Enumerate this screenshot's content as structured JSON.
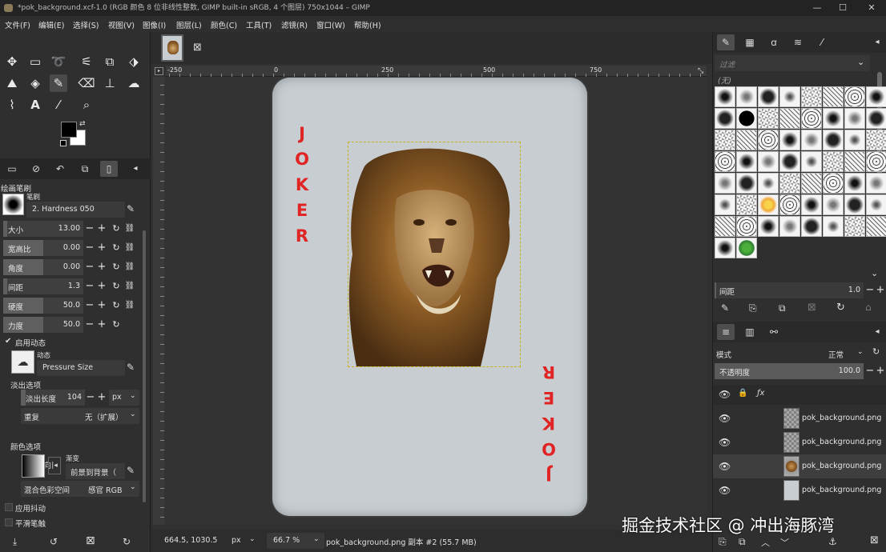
{
  "window": {
    "title": "*pok_background.xcf-1.0 (RGB 颜色 8 位非线性整数, GIMP built-in sRGB, 4 个图层) 750x1044 – GIMP",
    "minimize": "—",
    "maximize": "☐",
    "close": "✕"
  },
  "menu": [
    "文件(F)",
    "编辑(E)",
    "选择(S)",
    "视图(V)",
    "图像(I)",
    "图层(L)",
    "颜色(C)",
    "工具(T)",
    "滤镜(R)",
    "窗口(W)",
    "帮助(H)"
  ],
  "tool_options": {
    "section_title": "绘画笔刷",
    "brush_label": "笔刷",
    "brush_name": "2. Hardness 050",
    "sliders": [
      {
        "name": "大小",
        "value": "13.00",
        "fill": 0.05
      },
      {
        "name": "宽高比",
        "value": "0.00",
        "fill": 0.5
      },
      {
        "name": "角度",
        "value": "0.00",
        "fill": 0.5
      },
      {
        "name": "间距",
        "value": "1.3",
        "fill": 0.05
      },
      {
        "name": "硬度",
        "value": "50.0",
        "fill": 0.5
      },
      {
        "name": "力度",
        "value": "50.0",
        "fill": 0.5
      }
    ],
    "dynamics_enabled_label": "启用动态",
    "dynamics_label": "动态",
    "dynamics_value": "Pressure Size",
    "fade_section": "淡出选项",
    "fade_length_label": "淡出长度",
    "fade_length_value": "104",
    "fade_unit": "px",
    "repeat_label": "重复",
    "repeat_value": "无（扩展）",
    "reverse_label": "反向",
    "color_section": "颜色选项",
    "gradient_label": "渐变",
    "gradient_value": "前景到背景（",
    "blend_space_label": "混合色彩空间",
    "blend_space_value": "感官 RGB",
    "jitter_label": "应用抖动",
    "smooth_label": "平滑笔触"
  },
  "canvas": {
    "ruler_marks": [
      "-250",
      "0",
      "250",
      "500",
      "750"
    ],
    "card_text_top": [
      "J",
      "O",
      "K",
      "E",
      "R"
    ],
    "card_text_bottom": [
      "R",
      "E",
      "K",
      "O",
      "J"
    ]
  },
  "status": {
    "coords": "664.5, 1030.5",
    "unit": "px",
    "zoom": "66.7 %",
    "info": "pok_background.png 副本 #2 (55.7 MB)"
  },
  "brushes_panel": {
    "filter_placeholder": "过滤",
    "tag": "(无)",
    "spacing_label": "间距",
    "spacing_value": "1.0"
  },
  "layers_panel": {
    "mode_label": "模式",
    "mode_value": "正常",
    "opacity_label": "不透明度",
    "opacity_value": "100.0",
    "layers": [
      {
        "name": "pok_background.png",
        "thumb": "transparent"
      },
      {
        "name": "pok_background.png",
        "thumb": "transparent"
      },
      {
        "name": "pok_background.png",
        "thumb": "lion",
        "selected": true
      },
      {
        "name": "pok_background.png",
        "thumb": "card"
      }
    ]
  },
  "watermark": "掘金技术社区 @ 冲出海豚湾"
}
